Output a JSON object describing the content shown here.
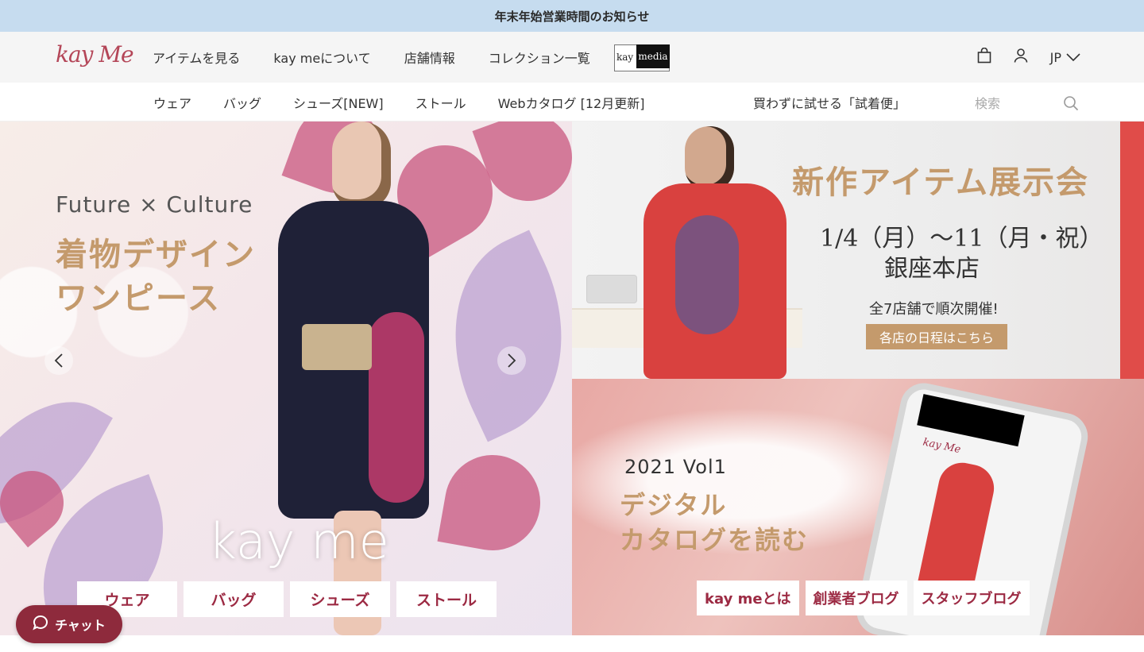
{
  "announcement": "年末年始営業時間のお知らせ",
  "brand": {
    "logo_text": "kay Me"
  },
  "main_menu": [
    {
      "label": "アイテムを見る"
    },
    {
      "label": "kay meについて"
    },
    {
      "label": "店舗情報"
    },
    {
      "label": "コレクション一覧"
    }
  ],
  "kaymedia": {
    "left": "kay",
    "right": "media"
  },
  "header_icons": {
    "cart": "bag-icon",
    "account": "user-icon",
    "language": "JP"
  },
  "sub_menu": [
    {
      "label": "ウェア"
    },
    {
      "label": "バッグ"
    },
    {
      "label": "シューズ[NEW]"
    },
    {
      "label": "ストール"
    },
    {
      "label": "Webカタログ [12月更新]"
    }
  ],
  "trial_link": "買わずに試せる「試着便」",
  "search": {
    "placeholder": "検索"
  },
  "hero": {
    "subtitle": "Future × Culture",
    "title_line1": "着物デザイン",
    "title_line2": "ワンピース",
    "brand_text": "kay me",
    "categories": [
      "ウェア",
      "バッグ",
      "シューズ",
      "ストール"
    ]
  },
  "exhibition": {
    "title": "新作アイテム展示会",
    "date": "1/4（月）〜11（月・祝）",
    "place": "銀座本店",
    "note": "全7店舗で順次開催!",
    "button": "各店の日程はこちら"
  },
  "catalog": {
    "subtitle": "2021 Vol1",
    "title_line1": "デジタル",
    "title_line2": "カタログを読む",
    "phone_logo": "kay Me",
    "links": [
      "kay meとは",
      "創業者ブログ",
      "スタッフブログ"
    ]
  },
  "chat": {
    "label": "チャット"
  }
}
